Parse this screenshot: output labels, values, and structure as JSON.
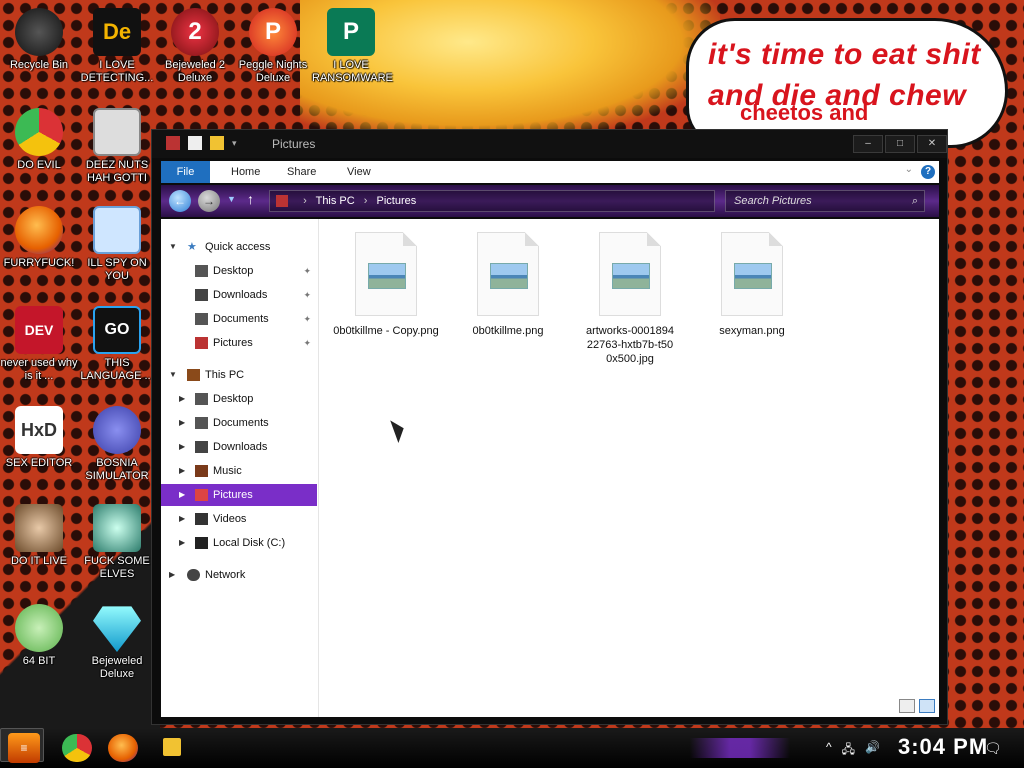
{
  "wallpaper": {
    "speech_line1": "it's time to eat shit",
    "speech_line2": "and die and chew",
    "speech_line3": "cheetos and"
  },
  "desktop_icons": [
    {
      "label": "Recycle Bin",
      "icon": "recycle-bin-icon"
    },
    {
      "label": "I LOVE DETECTING...",
      "icon": "de-icon"
    },
    {
      "label": "Bejeweled 2 Deluxe",
      "icon": "bejeweled2-icon"
    },
    {
      "label": "Peggle Nights Deluxe",
      "icon": "peggle-icon"
    },
    {
      "label": "I LOVE RANSOMWARE",
      "icon": "publisher-icon"
    },
    {
      "label": "DO EVIL",
      "icon": "chrome-icon"
    },
    {
      "label": "DEEZ NUTS HAH GOTTI",
      "icon": "stack-icon"
    },
    {
      "label": "FURRYFUCK!",
      "icon": "firefox-icon"
    },
    {
      "label": "ILL SPY ON YOU",
      "icon": "spy-icon"
    },
    {
      "label": "never used why is it ...",
      "icon": "devcpp-icon"
    },
    {
      "label": "THIS LANGUAGE ...",
      "icon": "go-icon"
    },
    {
      "label": "SEX EDITOR",
      "icon": "hxd-icon"
    },
    {
      "label": "BOSNIA SIMULATOR",
      "icon": "mine-icon"
    },
    {
      "label": "DO IT LIVE",
      "icon": "portrait-icon"
    },
    {
      "label": "FUCK SOME ELVES",
      "icon": "elf-icon"
    },
    {
      "label": "64 BIT",
      "icon": "peridot-icon"
    },
    {
      "label": "Bejeweled Deluxe",
      "icon": "gem-icon"
    }
  ],
  "window": {
    "title": "Pictures",
    "ribbon": {
      "file": "File",
      "home": "Home",
      "share": "Share",
      "view": "View"
    },
    "address": {
      "this_pc": "This PC",
      "pictures": "Pictures"
    },
    "search_placeholder": "Search Pictures",
    "nav": {
      "quick_access": "Quick access",
      "qa_desktop": "Desktop",
      "qa_downloads": "Downloads",
      "qa_documents": "Documents",
      "qa_pictures": "Pictures",
      "this_pc": "This PC",
      "pc_desktop": "Desktop",
      "pc_documents": "Documents",
      "pc_downloads": "Downloads",
      "pc_music": "Music",
      "pc_pictures": "Pictures",
      "pc_videos": "Videos",
      "pc_local_disk": "Local Disk (C:)",
      "network": "Network"
    },
    "files": [
      {
        "name": "0b0tkillme - Copy.png"
      },
      {
        "name": "0b0tkillme.png"
      },
      {
        "name": "artworks-000189422763-hxtb7b-t500x500.jpg"
      },
      {
        "name": "sexyman.png"
      }
    ]
  },
  "taskbar": {
    "clock": "3:04 PM"
  }
}
